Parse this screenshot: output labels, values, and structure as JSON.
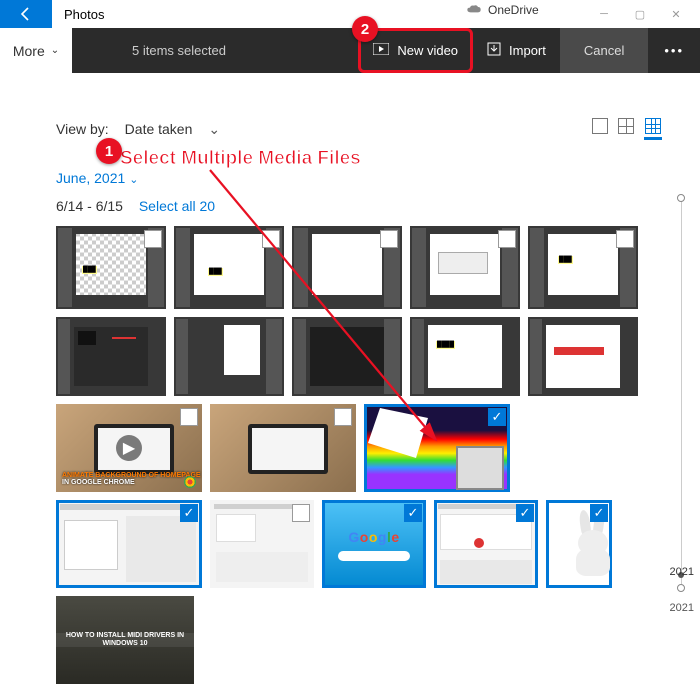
{
  "titlebar": {
    "app_title": "Photos",
    "onedrive_label": "OneDrive"
  },
  "actionbar": {
    "more_label": "More",
    "selection_count": "5 items selected",
    "new_video_label": "New video",
    "import_label": "Import",
    "cancel_label": "Cancel"
  },
  "viewby": {
    "label": "View by:",
    "value": "Date taken"
  },
  "annotation": {
    "step1_text": "Select Multiple Media Files",
    "step1_num": "1",
    "step2_num": "2"
  },
  "month": {
    "label": "June, 2021"
  },
  "daterow": {
    "range": "6/14 - 6/15",
    "select_all": "Select all 20"
  },
  "thumbs": {
    "video1_caption": "ANIMATE BACKGROUND OF HOMEPAGE",
    "video1_sub": "IN GOOGLE CHROME",
    "google_label": "Google",
    "midi_label": "HOW TO INSTALL MIDI DRIVERS IN WINDOWS 10"
  },
  "yearscroll": {
    "year": "2021",
    "current": "2021"
  }
}
